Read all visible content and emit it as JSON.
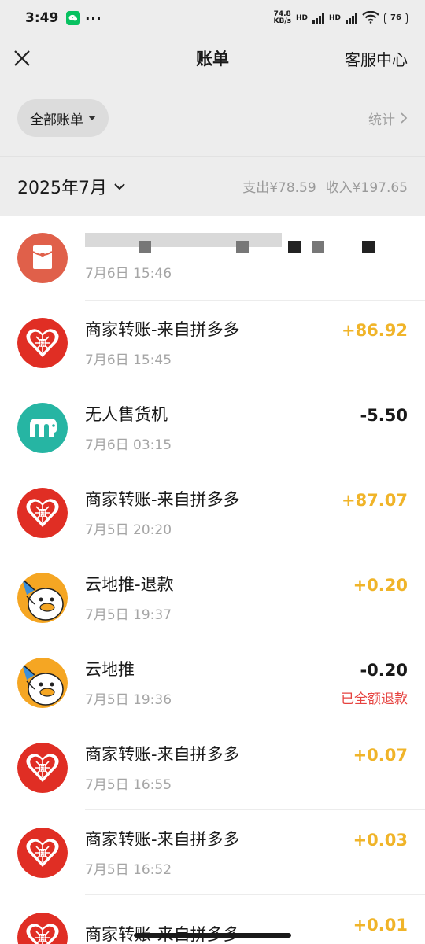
{
  "status_bar": {
    "time": "3:49",
    "dots": "···",
    "net_speed_value": "74.8",
    "net_speed_unit": "KB/s",
    "hd1": "HD",
    "hd2": "HD",
    "battery": "76"
  },
  "nav": {
    "title": "账单",
    "service": "客服中心"
  },
  "filter": {
    "all_bills": "全部账单",
    "stats": "统计"
  },
  "month": {
    "label": "2025年7月",
    "expense": "支出¥78.59",
    "income": "收入¥197.65"
  },
  "colors": {
    "income": "#f0b429",
    "refund": "#e64340",
    "pdd": "#e02e24",
    "vending": "#26b5a3",
    "yunditui": "#f5a623",
    "red_packet": "#e0604a"
  },
  "transactions": [
    {
      "icon": "red-packet-icon",
      "title": "",
      "time": "7月6日 15:46",
      "amount": "",
      "type": "income",
      "note": ""
    },
    {
      "icon": "pinduoduo-logo-icon",
      "title": "商家转账-来自拼多多",
      "time": "7月6日 15:45",
      "amount": "+86.92",
      "type": "income",
      "note": ""
    },
    {
      "icon": "vending-machine-icon",
      "title": "无人售货机",
      "time": "7月6日 03:15",
      "amount": "-5.50",
      "type": "expense",
      "note": ""
    },
    {
      "icon": "pinduoduo-logo-icon",
      "title": "商家转账-来自拼多多",
      "time": "7月5日 20:20",
      "amount": "+87.07",
      "type": "income",
      "note": ""
    },
    {
      "icon": "yunditui-duck-icon",
      "title": "云地推-退款",
      "time": "7月5日 19:37",
      "amount": "+0.20",
      "type": "income",
      "note": ""
    },
    {
      "icon": "yunditui-duck-icon",
      "title": "云地推",
      "time": "7月5日 19:36",
      "amount": "-0.20",
      "type": "expense",
      "note": "已全额退款"
    },
    {
      "icon": "pinduoduo-logo-icon",
      "title": "商家转账-来自拼多多",
      "time": "7月5日 16:55",
      "amount": "+0.07",
      "type": "income",
      "note": ""
    },
    {
      "icon": "pinduoduo-logo-icon",
      "title": "商家转账-来自拼多多",
      "time": "7月5日 16:52",
      "amount": "+0.03",
      "type": "income",
      "note": ""
    },
    {
      "icon": "pinduoduo-logo-icon",
      "title": "商家转账-来自拼多多",
      "time": "",
      "amount": "+0.01",
      "type": "income",
      "note": ""
    }
  ]
}
